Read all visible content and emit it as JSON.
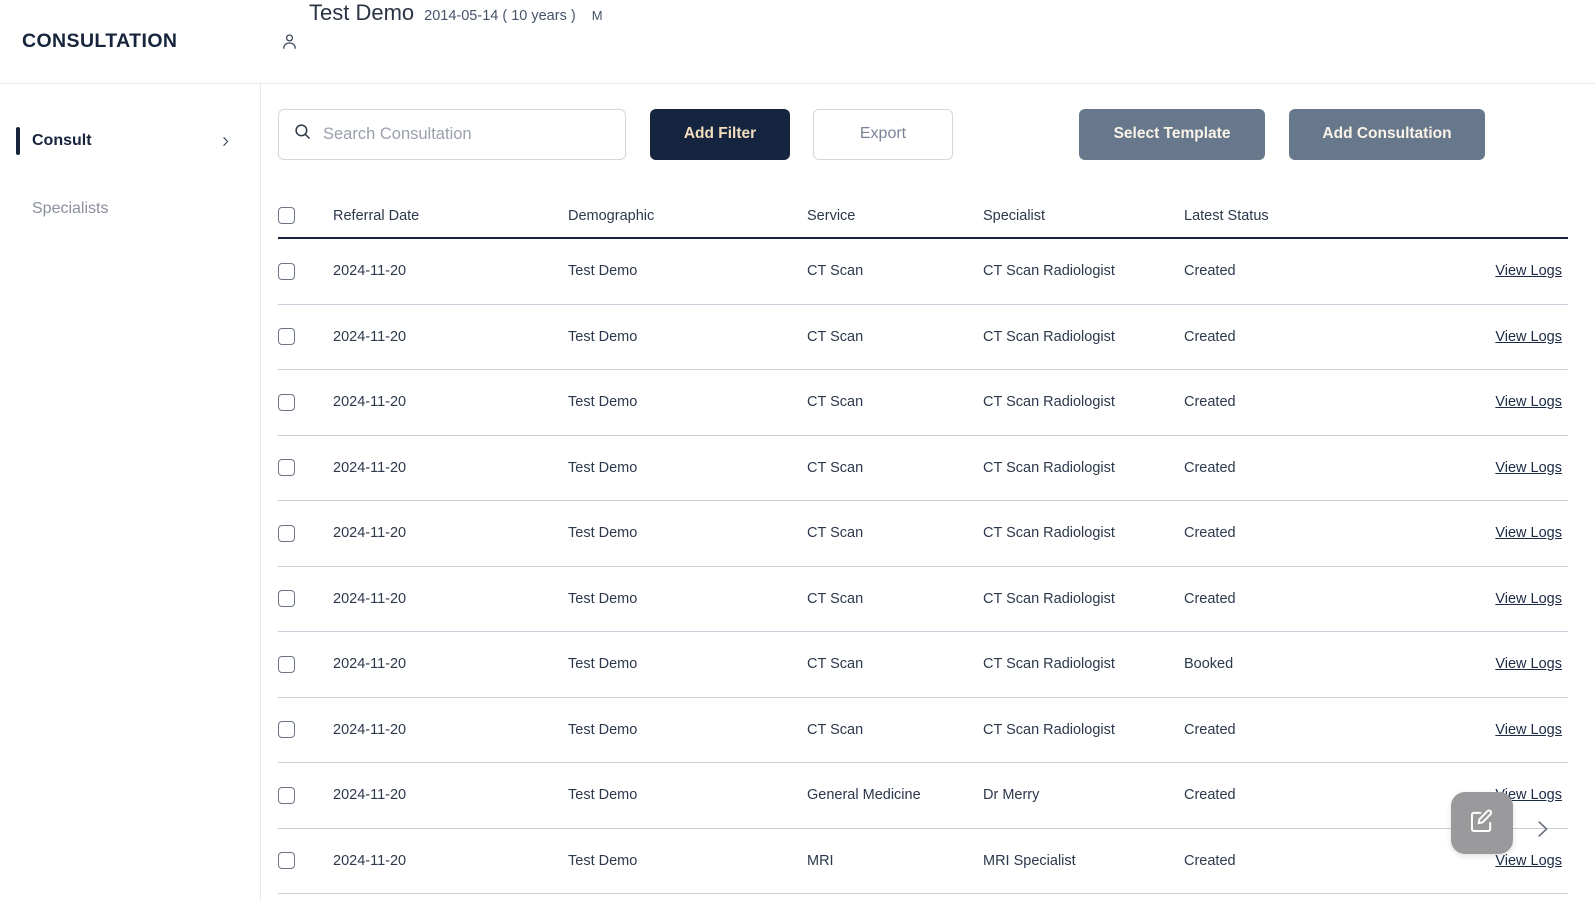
{
  "header": {
    "brand": "CONSULTATION",
    "patient": {
      "icon": "user-icon",
      "name": "Test Demo",
      "dob_age": "2014-05-14 ( 10 years )",
      "sex": "M"
    }
  },
  "sidebar": {
    "items": [
      {
        "label": "Consult",
        "active": true,
        "chevron": "chevron-right-icon"
      },
      {
        "label": "Specialists",
        "active": false
      }
    ]
  },
  "toolbar": {
    "search": {
      "icon": "search-icon",
      "value": "",
      "placeholder": "Search Consultation"
    },
    "add_filter_label": "Add Filter",
    "export_label": "Export",
    "select_template_label": "Select Template",
    "add_consultation_label": "Add Consultation"
  },
  "table": {
    "columns": [
      "Referral Date",
      "Demographic",
      "Service",
      "Specialist",
      "Latest Status"
    ],
    "action_label": "View Logs",
    "rows": [
      {
        "date": "2024-11-20",
        "demographic": "Test Demo",
        "service": "CT Scan",
        "specialist": "CT Scan Radiologist",
        "status": "Created",
        "action": "View Logs"
      },
      {
        "date": "2024-11-20",
        "demographic": "Test Demo",
        "service": "CT Scan",
        "specialist": "CT Scan Radiologist",
        "status": "Created",
        "action": "View Logs"
      },
      {
        "date": "2024-11-20",
        "demographic": "Test Demo",
        "service": "CT Scan",
        "specialist": "CT Scan Radiologist",
        "status": "Created",
        "action": "View Logs"
      },
      {
        "date": "2024-11-20",
        "demographic": "Test Demo",
        "service": "CT Scan",
        "specialist": "CT Scan Radiologist",
        "status": "Created",
        "action": "View Logs"
      },
      {
        "date": "2024-11-20",
        "demographic": "Test Demo",
        "service": "CT Scan",
        "specialist": "CT Scan Radiologist",
        "status": "Created",
        "action": "View Logs"
      },
      {
        "date": "2024-11-20",
        "demographic": "Test Demo",
        "service": "CT Scan",
        "specialist": "CT Scan Radiologist",
        "status": "Created",
        "action": "View Logs"
      },
      {
        "date": "2024-11-20",
        "demographic": "Test Demo",
        "service": "CT Scan",
        "specialist": "CT Scan Radiologist",
        "status": "Booked",
        "action": "View Logs"
      },
      {
        "date": "2024-11-20",
        "demographic": "Test Demo",
        "service": "CT Scan",
        "specialist": "CT Scan Radiologist",
        "status": "Created",
        "action": "View Logs"
      },
      {
        "date": "2024-11-20",
        "demographic": "Test Demo",
        "service": "General Medicine",
        "specialist": "Dr Merry",
        "status": "Created",
        "action": "View Logs"
      },
      {
        "date": "2024-11-20",
        "demographic": "Test Demo",
        "service": "MRI",
        "specialist": "MRI Specialist",
        "status": "Created",
        "action": "View Logs"
      }
    ]
  },
  "floating": {
    "edit_icon": "edit-square-icon",
    "next_icon": "chevron-right-icon"
  },
  "colors": {
    "navy": "#15253f",
    "gold_text": "#f3debf",
    "slate_button": "#68788c",
    "row_border": "#c9ced8",
    "fab_gray": "#9a9a9c"
  }
}
